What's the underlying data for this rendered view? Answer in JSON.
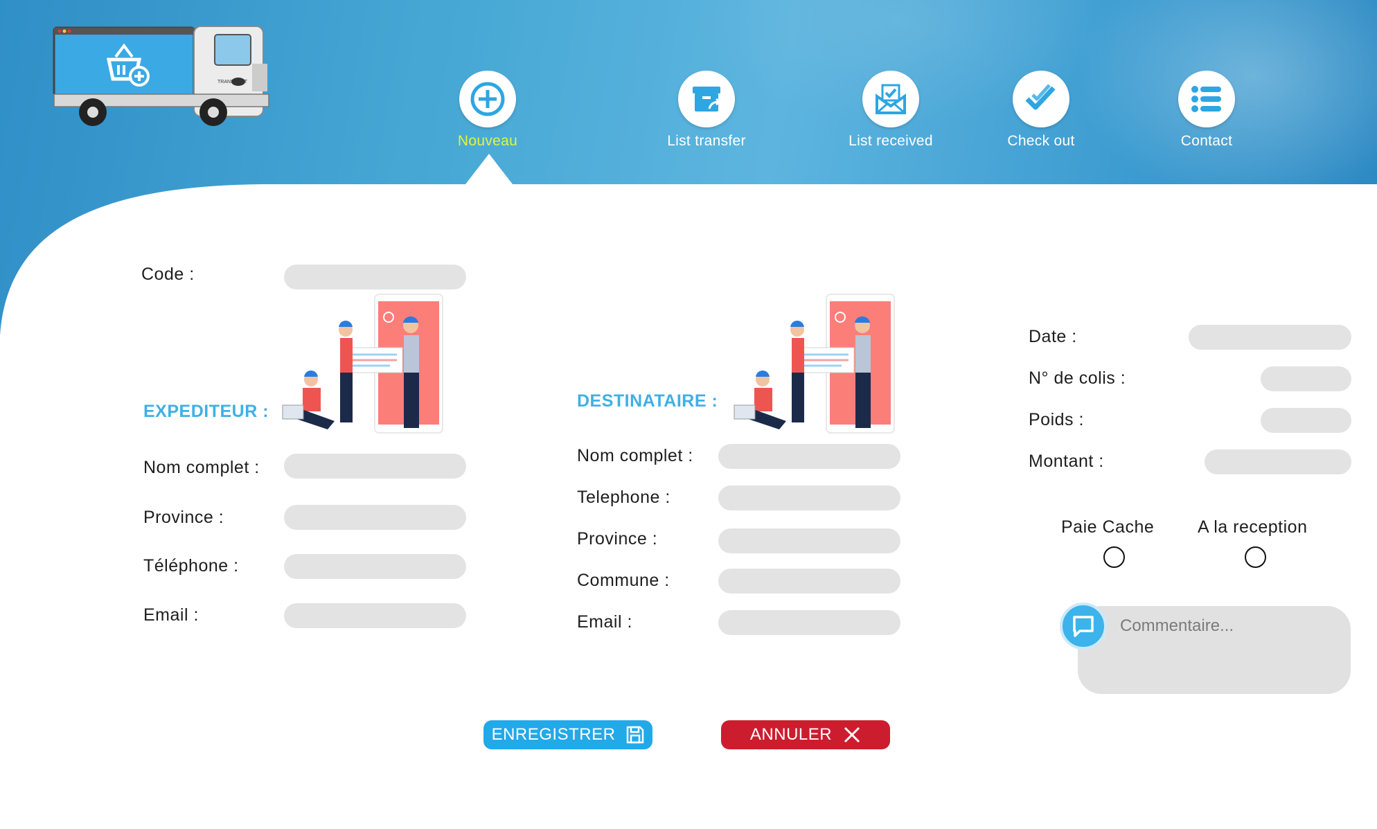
{
  "nav": {
    "items": [
      {
        "label": "Nouveau",
        "icon": "plus-circle-icon",
        "active": true
      },
      {
        "label": "List transfer",
        "icon": "box-transfer-icon",
        "active": false
      },
      {
        "label": "List received",
        "icon": "mail-check-icon",
        "active": false
      },
      {
        "label": "Check out",
        "icon": "double-check-icon",
        "active": false
      },
      {
        "label": "Contact",
        "icon": "list-icon",
        "active": false
      }
    ]
  },
  "logo": {
    "truck_text": "TRANSPORT",
    "icon": "basket-plus-icon"
  },
  "code": {
    "label": "Code :",
    "value": ""
  },
  "sender": {
    "title": "EXPEDITEUR :",
    "fields": {
      "full_name": {
        "label": "Nom complet :",
        "value": ""
      },
      "province": {
        "label": "Province :",
        "value": ""
      },
      "phone": {
        "label": "Téléphone :",
        "value": ""
      },
      "email": {
        "label": "Email :",
        "value": ""
      }
    }
  },
  "recipient": {
    "title": "DESTINATAIRE :",
    "fields": {
      "full_name": {
        "label": "Nom complet :",
        "value": ""
      },
      "phone": {
        "label": "Telephone :",
        "value": ""
      },
      "province": {
        "label": "Province :",
        "value": ""
      },
      "commune": {
        "label": "Commune :",
        "value": ""
      },
      "email": {
        "label": "Email :",
        "value": ""
      }
    }
  },
  "details": {
    "date": {
      "label": "Date :",
      "value": ""
    },
    "parcel_count": {
      "label": "N° de colis :",
      "value": ""
    },
    "weight": {
      "label": "Poids :",
      "value": ""
    },
    "amount": {
      "label": "Montant :",
      "value": ""
    }
  },
  "payment": {
    "options": [
      {
        "label": "Paie Cache",
        "selected": false
      },
      {
        "label": "A la reception",
        "selected": false
      }
    ]
  },
  "comment": {
    "placeholder": "Commentaire...",
    "icon": "chat-bubble-icon"
  },
  "buttons": {
    "save": {
      "label": "ENREGISTRER",
      "icon": "floppy-disk-icon",
      "color": "#22a9e8"
    },
    "cancel": {
      "label": "ANNULER",
      "icon": "close-x-icon",
      "color": "#cc1d2e"
    }
  },
  "colors": {
    "accent": "#3fb0e5",
    "active_nav": "#e4f53a",
    "field_bg": "#e3e3e3"
  }
}
